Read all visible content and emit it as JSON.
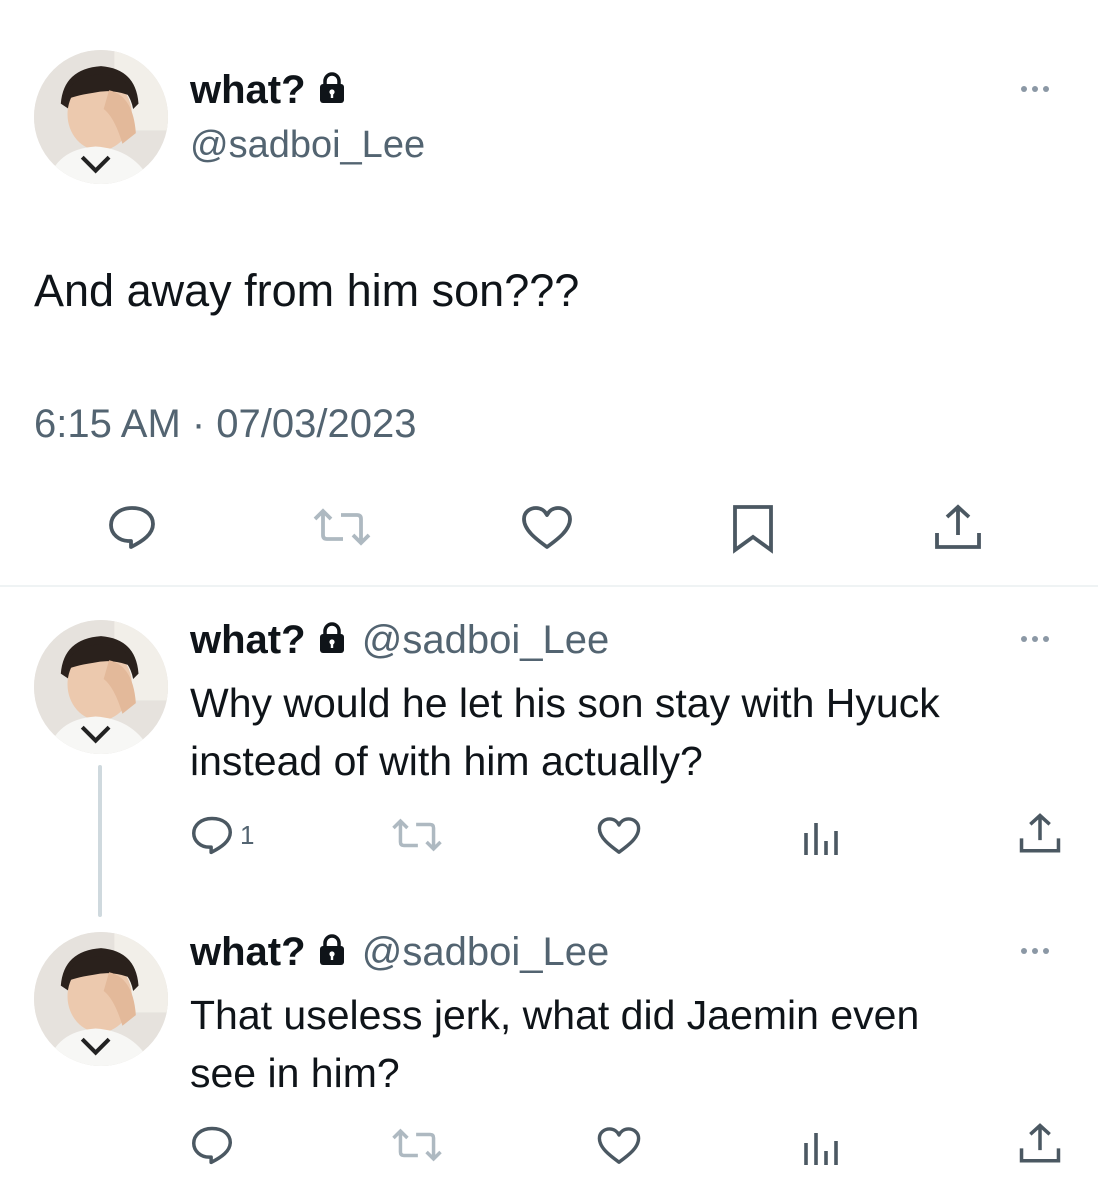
{
  "main_tweet": {
    "display_name": "what?",
    "handle": "@sadboi_Lee",
    "text": "And away from him son???",
    "timestamp": "6:15 AM · 07/03/2023",
    "actions": [
      "reply-icon",
      "retweet-icon",
      "like-icon",
      "bookmark-icon",
      "share-icon"
    ]
  },
  "replies": [
    {
      "display_name": "what?",
      "handle": "@sadboi_Lee",
      "text_line1": "Why would he let his son stay with Hyuck",
      "text_line2": "instead of with him actually?",
      "reply_count": "1",
      "actions": [
        "reply-icon",
        "retweet-icon",
        "like-icon",
        "views-icon",
        "share-icon"
      ]
    },
    {
      "display_name": "what?",
      "handle": "@sadboi_Lee",
      "text_line1": "That useless jerk, what did Jaemin even",
      "text_line2": "see in him?",
      "reply_count": "",
      "actions": [
        "reply-icon",
        "retweet-icon",
        "like-icon",
        "views-icon",
        "share-icon"
      ]
    }
  ],
  "colors": {
    "primary_text": "#0f1419",
    "secondary_text": "#536471",
    "divider": "#eff3f4",
    "thread_line": "#cfd9de"
  }
}
